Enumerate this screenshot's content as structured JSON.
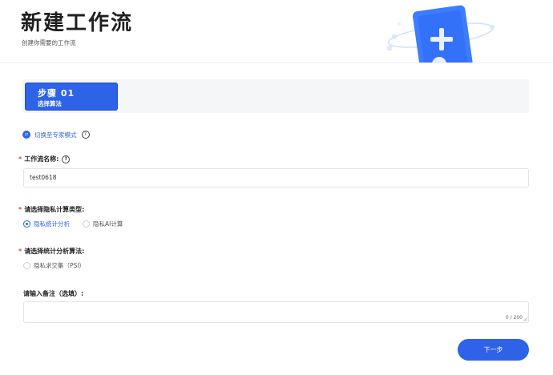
{
  "header": {
    "title": "新建工作流",
    "subtitle": "创建你需要的工作流",
    "illustration": "plus-card-illustration"
  },
  "steps": [
    {
      "number": "步骤  01",
      "name": "选择算法",
      "active": true
    }
  ],
  "mode_toggle": {
    "label": "切换至专家模式",
    "icon": "swap-icon"
  },
  "workflow_name": {
    "label": "工作流名称:",
    "required": true,
    "value": "test0618"
  },
  "privacy_type": {
    "label": "请选择隐私计算类型:",
    "required": true,
    "options": [
      {
        "label": "隐私统计分析",
        "selected": true
      },
      {
        "label": "隐私AI计算",
        "selected": false
      }
    ]
  },
  "algorithm": {
    "label": "请选择统计分析算法:",
    "required": true,
    "options": [
      {
        "label": "隐私求交集（PSI）",
        "selected": false
      }
    ]
  },
  "remark": {
    "label": "请输入备注（选填）:",
    "value": "",
    "counter": "0 / 200"
  },
  "next_button": {
    "label": "下一步"
  },
  "colors": {
    "primary": "#2e63e8",
    "required": "#e2453c",
    "panel": "#f5f6f8"
  }
}
